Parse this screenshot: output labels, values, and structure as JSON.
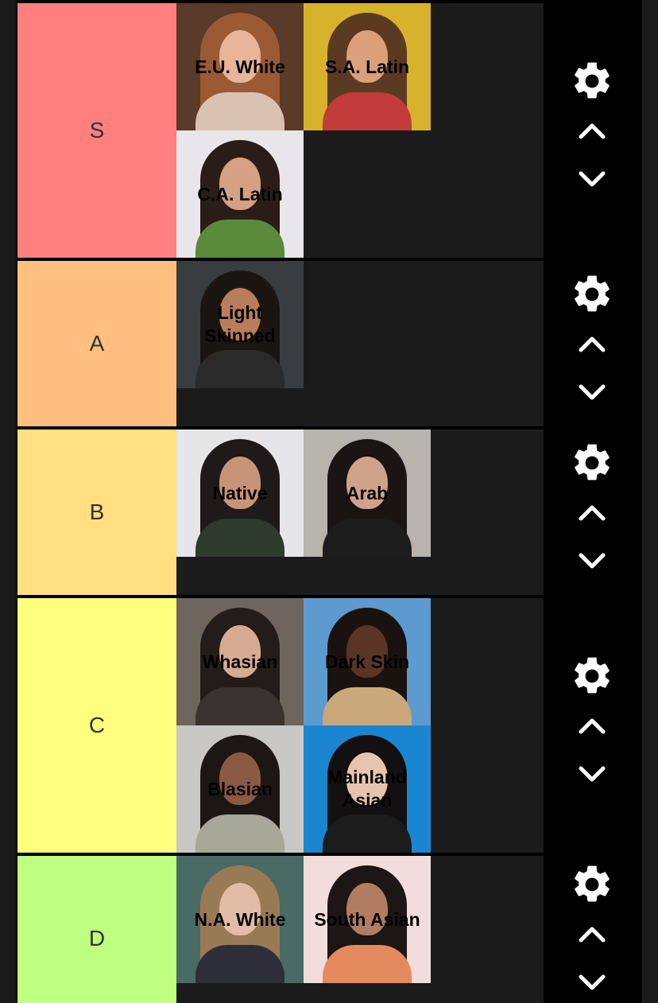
{
  "tiers": [
    {
      "label": "S",
      "color": "#ff7f7f",
      "items": [
        {
          "name": "E.U. White",
          "bg": "#5a3a28",
          "hair": "#9a5a34",
          "skin": "#e8b59a",
          "top": "#d9c2b0"
        },
        {
          "name": "S.A. Latin",
          "bg": "#d6b32a",
          "hair": "#5c3a22",
          "skin": "#d9a07a",
          "top": "#c23b3b"
        },
        {
          "name": "C.A. Latin",
          "bg": "#e8e6ea",
          "hair": "#2a1c16",
          "skin": "#d4a185",
          "top": "#5a8a3a"
        }
      ]
    },
    {
      "label": "A",
      "color": "#ffbf7f",
      "items": [
        {
          "name": "Light Skinned",
          "bg": "#3a3d40",
          "hair": "#1b1512",
          "skin": "#b97d5c",
          "top": "#2a2a2a"
        }
      ]
    },
    {
      "label": "B",
      "color": "#ffdf7f",
      "items": [
        {
          "name": "Native",
          "bg": "#e6e6e8",
          "hair": "#1f1a1a",
          "skin": "#c89478",
          "top": "#2d3a2c"
        },
        {
          "name": "Arab",
          "bg": "#b9b3ad",
          "hair": "#1a1414",
          "skin": "#cfa38a",
          "top": "#1c1c1c"
        }
      ]
    },
    {
      "label": "C",
      "color": "#ffff7f",
      "items": [
        {
          "name": "Whasian",
          "bg": "#6e655e",
          "hair": "#241c19",
          "skin": "#d6ab92",
          "top": "#3a3330"
        },
        {
          "name": "Dark Skin",
          "bg": "#5d9ad0",
          "hair": "#1a120f",
          "skin": "#5a3526",
          "top": "#caa87a"
        },
        {
          "name": "Blasian",
          "bg": "#c9c8c4",
          "hair": "#1d1714",
          "skin": "#8a5a42",
          "top": "#a7a79a"
        },
        {
          "name": "Mainland Asian",
          "bg": "#1b86d0",
          "hair": "#141012",
          "skin": "#e6c4ae",
          "top": "#1c1c1c"
        }
      ]
    },
    {
      "label": "D",
      "color": "#bfff7f",
      "items": [
        {
          "name": "N.A. White",
          "bg": "#4a6a66",
          "hair": "#9a7a55",
          "skin": "#e2bca4",
          "top": "#2e2e38"
        },
        {
          "name": "South Asian",
          "bg": "#f1dedc",
          "hair": "#1c1614",
          "skin": "#b27c60",
          "top": "#e58a5e"
        }
      ]
    }
  ],
  "icons": {
    "settings": "gear-icon",
    "move_up": "chevron-up-icon",
    "move_down": "chevron-down-icon"
  }
}
